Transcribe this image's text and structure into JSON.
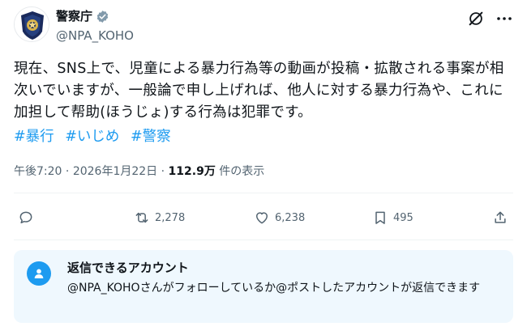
{
  "account": {
    "display_name": "警察庁",
    "handle": "@NPA_KOHO"
  },
  "post": {
    "text": "現在、SNS上で、児童による暴力行為等の動画が投稿・拡散される事案が相次いでいますが、一般論で申し上げれば、他人に対する暴力行為や、これに加担して帮助(ほうじょ)する行為は犯罪です。",
    "hashtags": [
      "#暴行",
      "#いじめ",
      "#警察"
    ]
  },
  "meta": {
    "time": "午後7:20",
    "separator": "·",
    "date": "2026年1月22日",
    "views_count": "112.9万",
    "views_label": "件の表示"
  },
  "actions": {
    "reply_count": "",
    "repost_count": "2,278",
    "like_count": "6,238",
    "bookmark_count": "495"
  },
  "reply_restriction": {
    "title": "返信できるアカウント",
    "description": "@NPA_KOHOさんがフォローしているか@ポストしたアカウントが返信できます"
  },
  "colors": {
    "accent": "#1d9bf0",
    "text": "#0f1419",
    "muted": "#536471",
    "reply_box_bg": "#eff8fe",
    "verified_badge": "#829aab"
  },
  "icons": [
    "police-emblem-avatar",
    "verified-badge-icon",
    "grok-icon",
    "more-icon",
    "reply-icon",
    "repost-icon",
    "like-icon",
    "bookmark-icon",
    "share-icon",
    "user-icon"
  ]
}
